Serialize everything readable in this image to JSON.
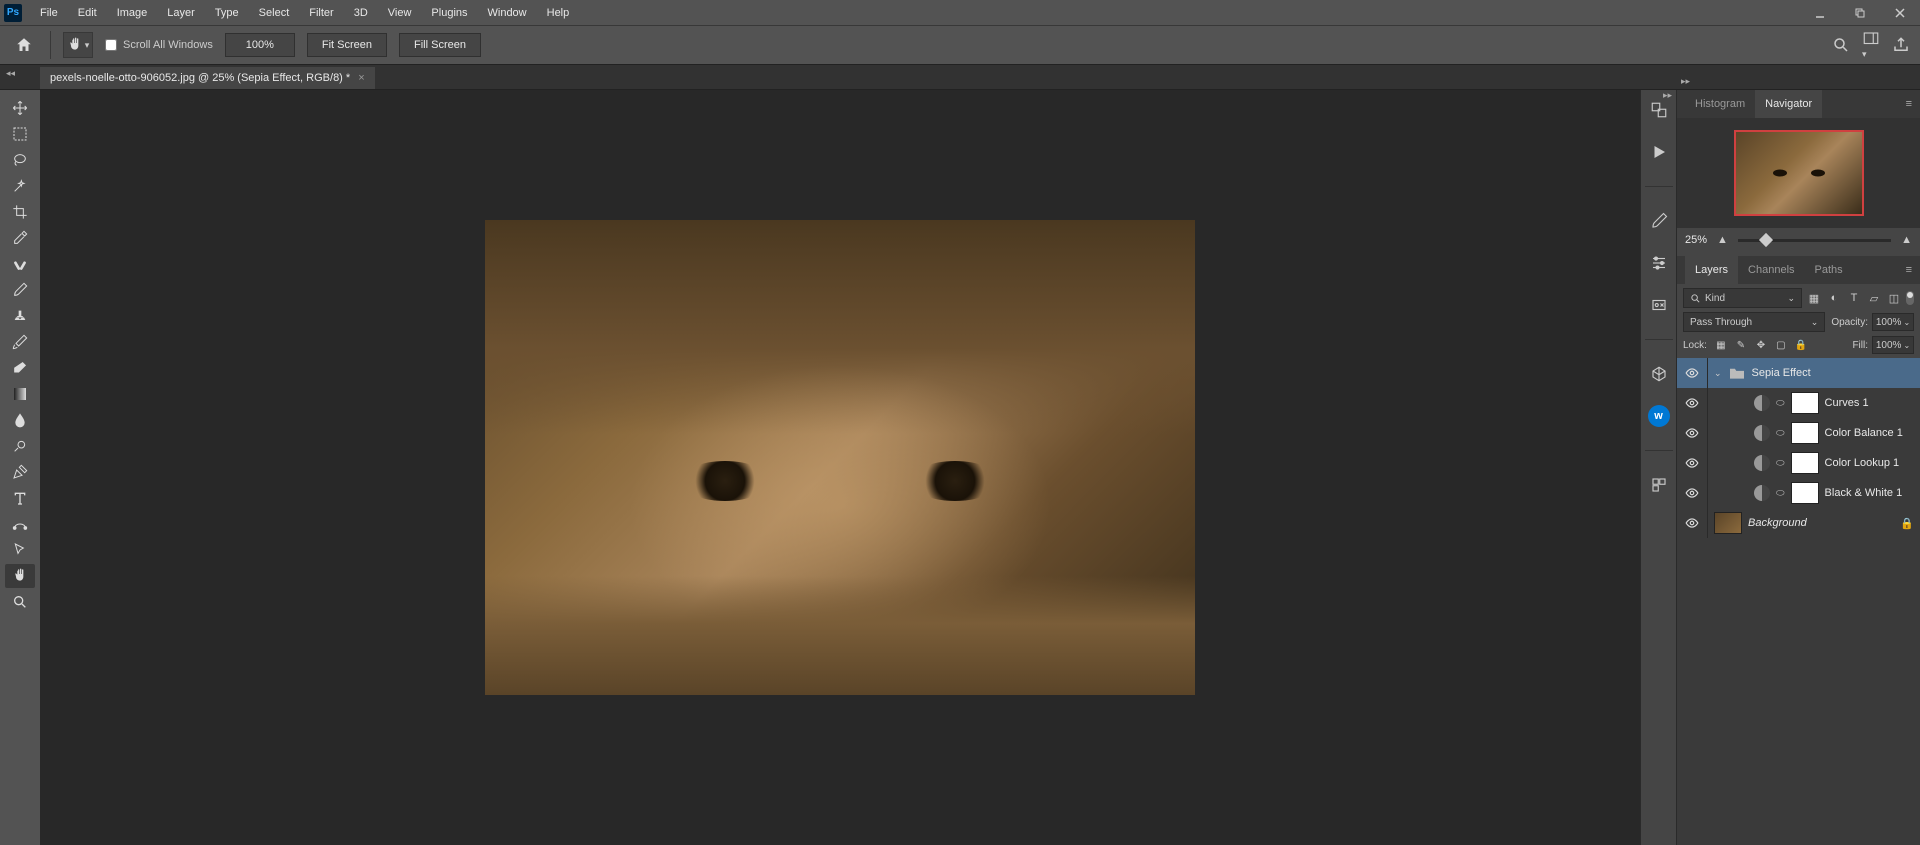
{
  "menu": [
    "File",
    "Edit",
    "Image",
    "Layer",
    "Type",
    "Select",
    "Filter",
    "3D",
    "View",
    "Plugins",
    "Window",
    "Help"
  ],
  "options": {
    "scroll_all": "Scroll All Windows",
    "zoom": "100%",
    "fit_screen": "Fit Screen",
    "fill_screen": "Fill Screen"
  },
  "tab": {
    "title": "pexels-noelle-otto-906052.jpg @ 25% (Sepia Effect, RGB/8) *"
  },
  "nav_panel": {
    "tabs": [
      "Histogram",
      "Navigator"
    ],
    "zoom": "25%"
  },
  "layers_panel": {
    "tabs": [
      "Layers",
      "Channels",
      "Paths"
    ],
    "kind": "Kind",
    "blend": "Pass Through",
    "opacity_label": "Opacity:",
    "opacity": "100%",
    "lock_label": "Lock:",
    "fill_label": "Fill:",
    "fill": "100%",
    "layers": [
      {
        "name": "Sepia Effect",
        "type": "group",
        "selected": true
      },
      {
        "name": "Curves 1",
        "type": "adj"
      },
      {
        "name": "Color Balance 1",
        "type": "adj"
      },
      {
        "name": "Color Lookup 1",
        "type": "adj"
      },
      {
        "name": "Black & White 1",
        "type": "adj"
      },
      {
        "name": "Background",
        "type": "bg",
        "locked": true
      }
    ]
  }
}
